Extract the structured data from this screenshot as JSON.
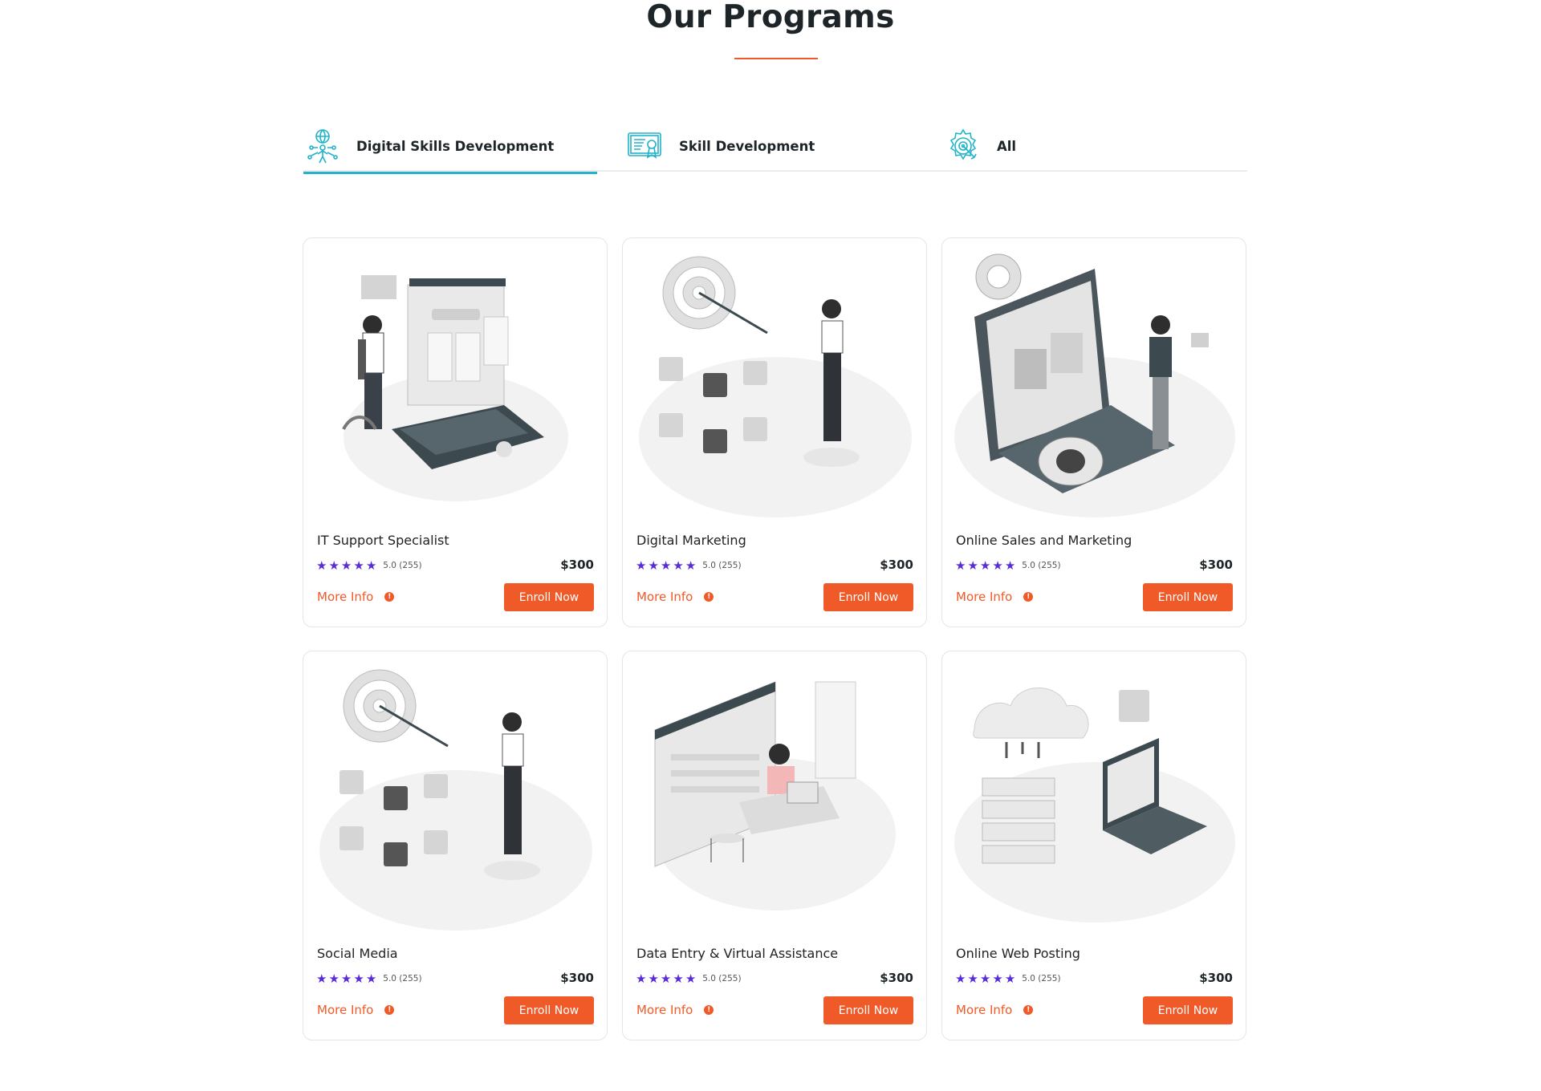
{
  "header": {
    "title": "Our Programs"
  },
  "tabs": [
    {
      "label": "Digital Skills Development",
      "icon": "network-person-icon",
      "active": true
    },
    {
      "label": "Skill Development",
      "icon": "certificate-icon",
      "active": false
    },
    {
      "label": "All",
      "icon": "gear-target-icon",
      "active": false
    }
  ],
  "colors": {
    "accent": "#f05a28",
    "tab_active": "#20b3c9",
    "star": "#5a2bd8",
    "icon_teal": "#20b3c9"
  },
  "cards": [
    {
      "title": "IT Support Specialist",
      "rating": "5.0 (255)",
      "price": "$300",
      "more_info": "More Info",
      "enroll": "Enroll Now",
      "stars": 5
    },
    {
      "title": "Digital Marketing",
      "rating": "5.0 (255)",
      "price": "$300",
      "more_info": "More Info",
      "enroll": "Enroll Now",
      "stars": 5
    },
    {
      "title": "Online Sales and Marketing",
      "rating": "5.0 (255)",
      "price": "$300",
      "more_info": "More Info",
      "enroll": "Enroll Now",
      "stars": 5
    },
    {
      "title": "Social Media",
      "rating": "5.0 (255)",
      "price": "$300",
      "more_info": "More Info",
      "enroll": "Enroll Now",
      "stars": 5
    },
    {
      "title": "Data Entry & Virtual Assistance",
      "rating": "5.0 (255)",
      "price": "$300",
      "more_info": "More Info",
      "enroll": "Enroll Now",
      "stars": 5
    },
    {
      "title": "Online Web Posting",
      "rating": "5.0 (255)",
      "price": "$300",
      "more_info": "More Info",
      "enroll": "Enroll Now",
      "stars": 5
    }
  ]
}
